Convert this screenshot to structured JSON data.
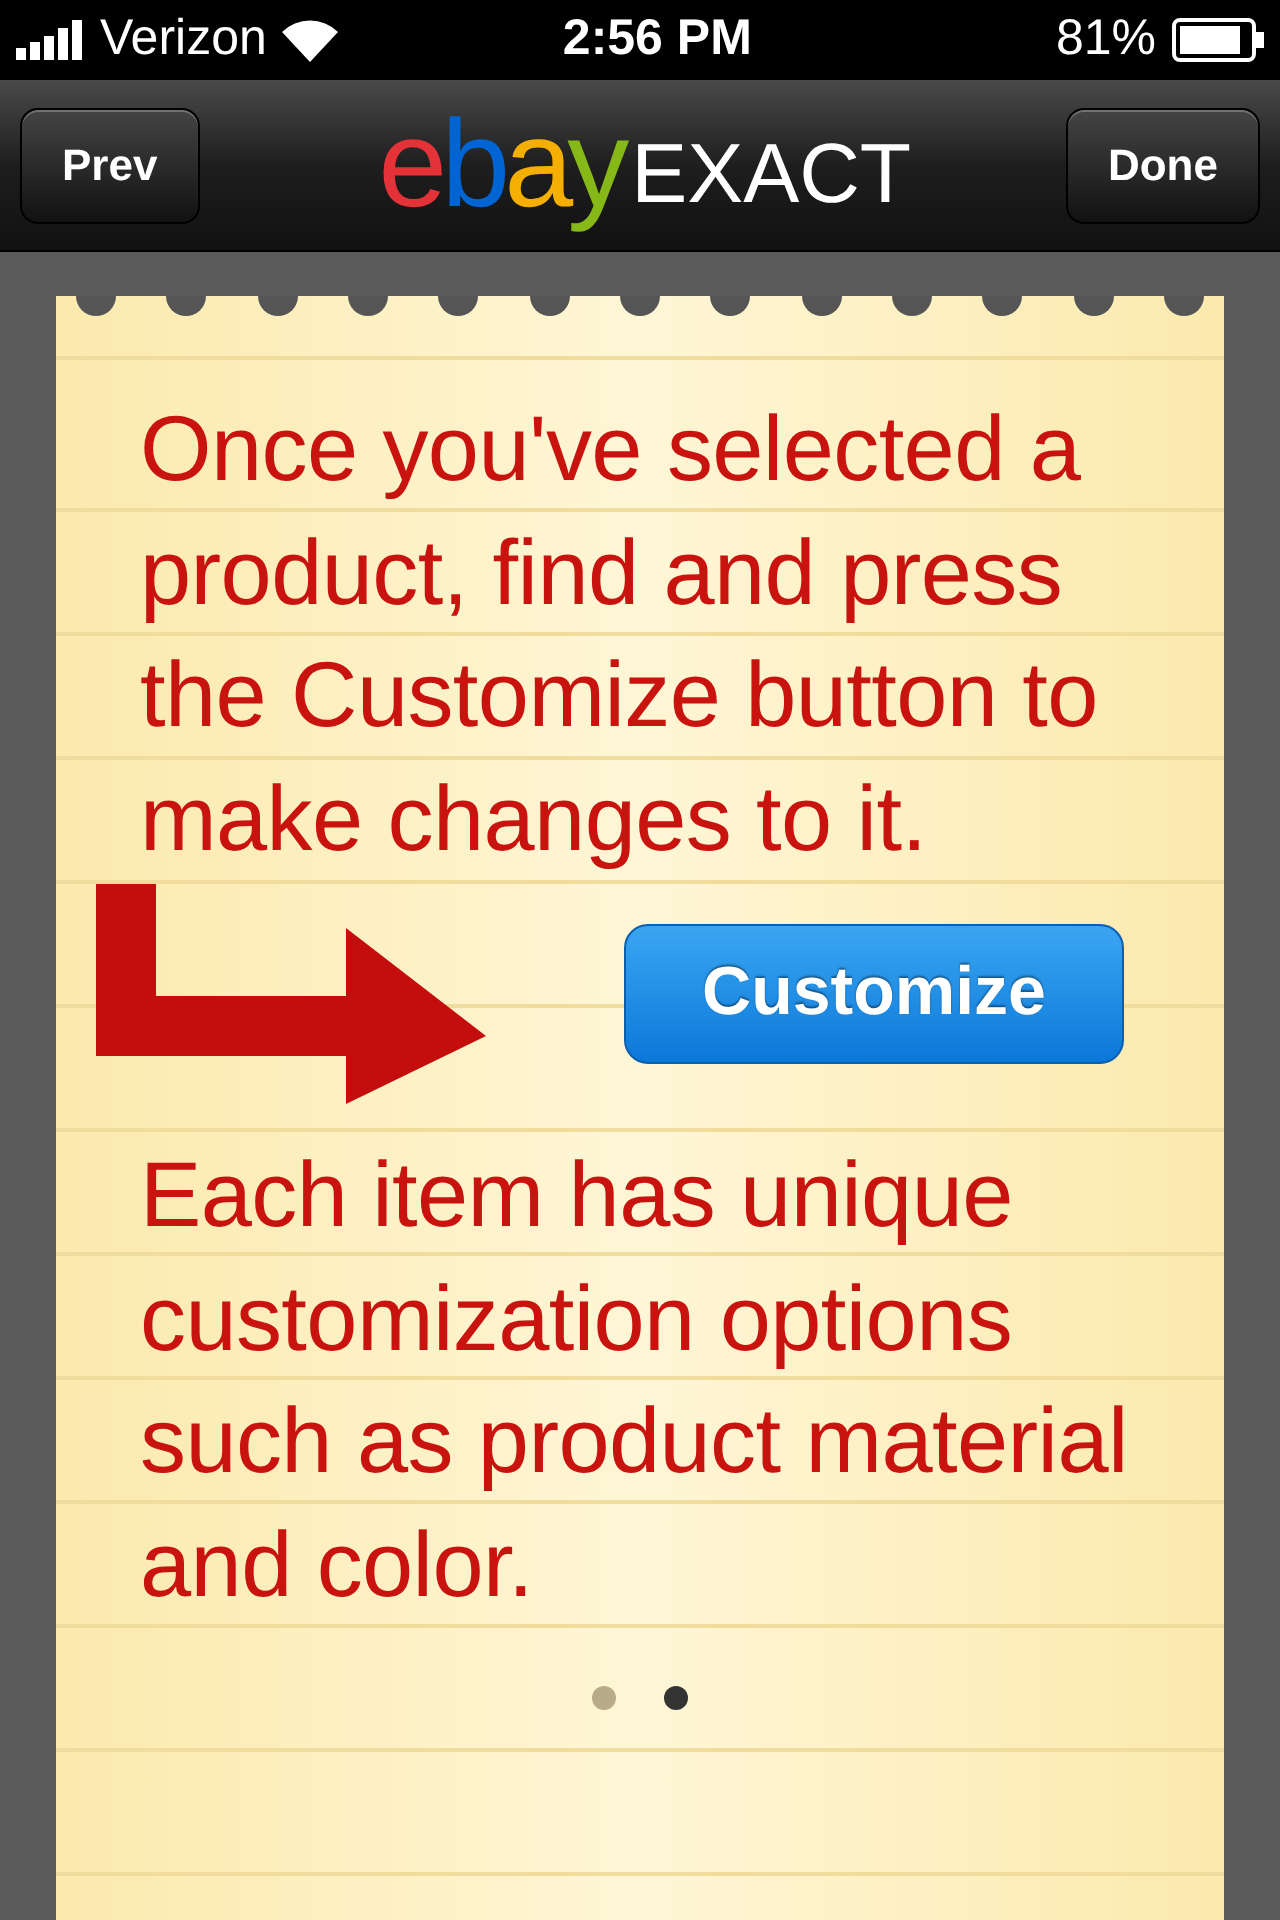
{
  "status_bar": {
    "carrier": "Verizon",
    "time": "2:56 PM",
    "battery": "81%"
  },
  "nav_bar": {
    "prev_button": "Prev",
    "done_button": "Done",
    "logo": {
      "letters": [
        {
          "text": "e",
          "color": "#e53238"
        },
        {
          "text": "b",
          "color": "#0064d2"
        },
        {
          "text": "a",
          "color": "#f5af02"
        },
        {
          "text": "y",
          "color": "#86b817"
        }
      ],
      "suffix": "EXACT"
    }
  },
  "tip": {
    "paragraphs": [
      "Once you've selected a product, find and press the Customize button to make changes to it.",
      "Each item has unique customization options such as product material and color."
    ],
    "example_button": "Customize"
  },
  "page_dots": [
    {
      "selected": false
    },
    {
      "selected": true
    }
  ]
}
